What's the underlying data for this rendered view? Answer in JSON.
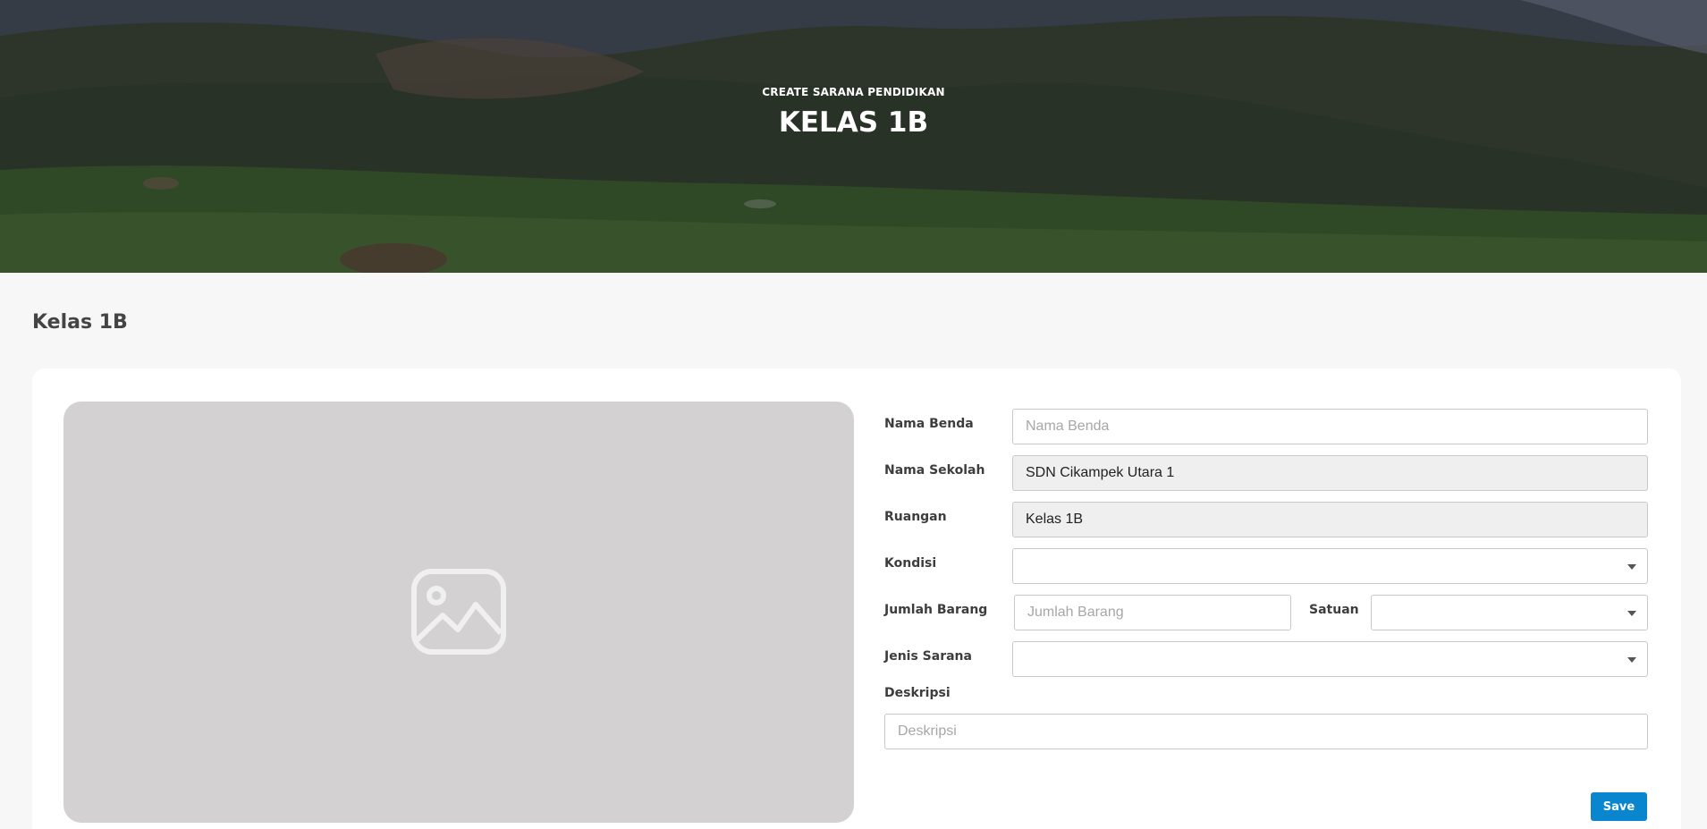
{
  "hero": {
    "subtitle": "CREATE SARANA PENDIDIKAN",
    "title": "KELAS 1B"
  },
  "page": {
    "title": "Kelas 1B"
  },
  "image": {
    "icon": "image-placeholder-icon"
  },
  "form": {
    "nama_benda": {
      "label": "Nama Benda",
      "placeholder": "Nama Benda",
      "value": ""
    },
    "nama_sekolah": {
      "label": "Nama Sekolah",
      "value": "SDN Cikampek Utara 1"
    },
    "ruangan": {
      "label": "Ruangan",
      "value": "Kelas 1B"
    },
    "kondisi": {
      "label": "Kondisi",
      "value": ""
    },
    "jumlah_barang": {
      "label": "Jumlah Barang",
      "placeholder": "Jumlah Barang",
      "value": ""
    },
    "satuan": {
      "label": "Satuan",
      "value": ""
    },
    "jenis_sarana": {
      "label": "Jenis Sarana",
      "value": ""
    },
    "deskripsi": {
      "label": "Deskripsi",
      "placeholder": "Deskripsi",
      "value": ""
    },
    "save_label": "Save"
  },
  "colors": {
    "accent": "#0a86cf",
    "placeholder_bg": "#d3d1d2",
    "readonly_bg": "#efefef"
  }
}
